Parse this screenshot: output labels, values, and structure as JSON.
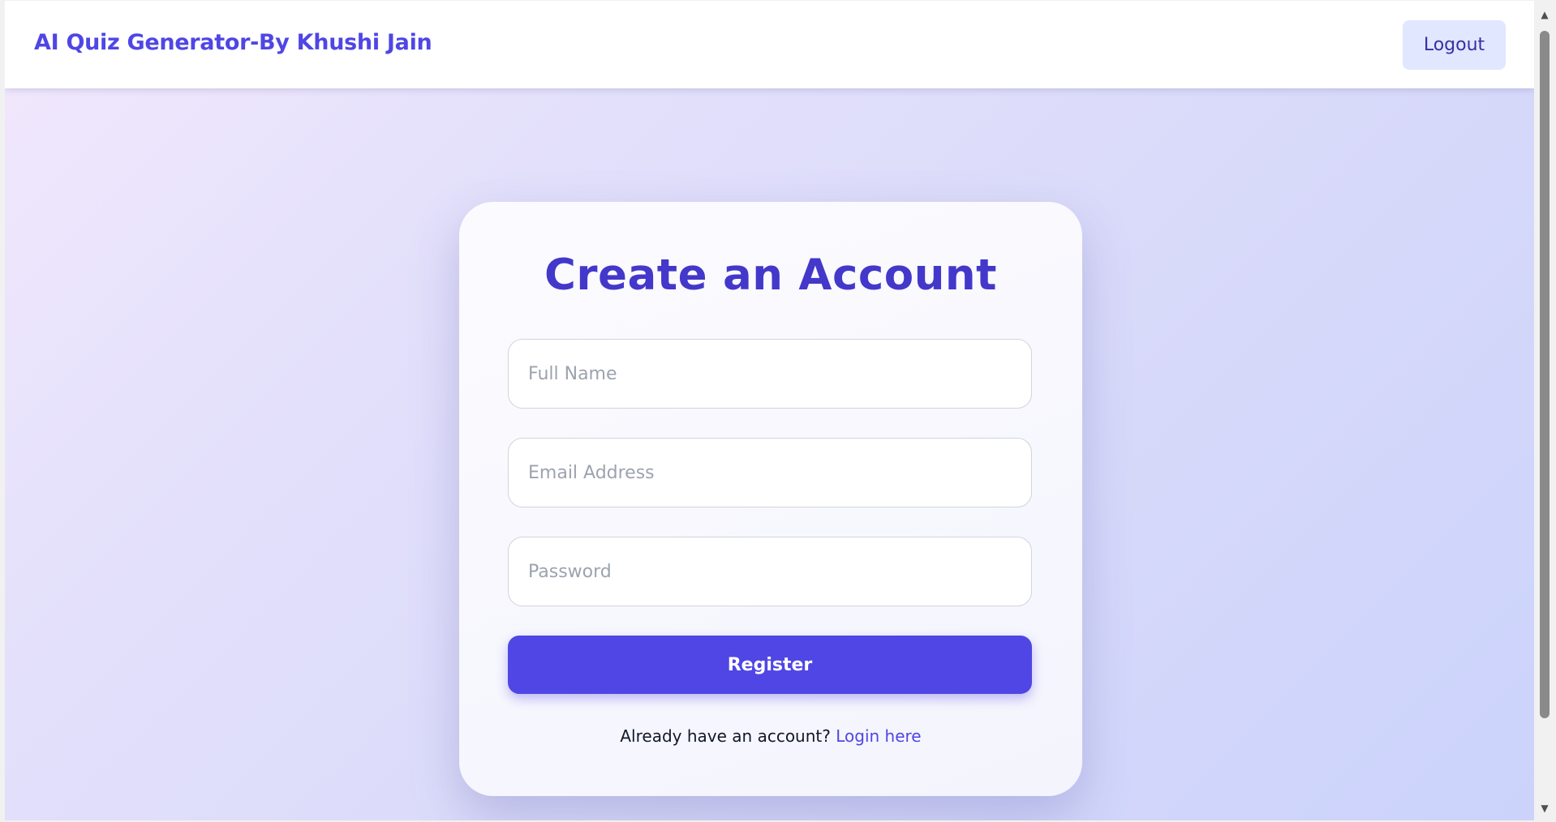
{
  "header": {
    "brand": "AI Quiz Generator-By Khushi Jain",
    "logout_label": "Logout"
  },
  "form": {
    "title": "Create an Account",
    "full_name_placeholder": "Full Name",
    "email_placeholder": "Email Address",
    "password_placeholder": "Password",
    "register_label": "Register",
    "login_prompt": "Already have an account?",
    "login_link": "Login here"
  },
  "scrollbar": {
    "up_icon": "▲",
    "down_icon": "▼"
  },
  "colors": {
    "accent": "#4f46e5",
    "title": "#4338ca",
    "logout_bg": "#e0e7ff"
  }
}
